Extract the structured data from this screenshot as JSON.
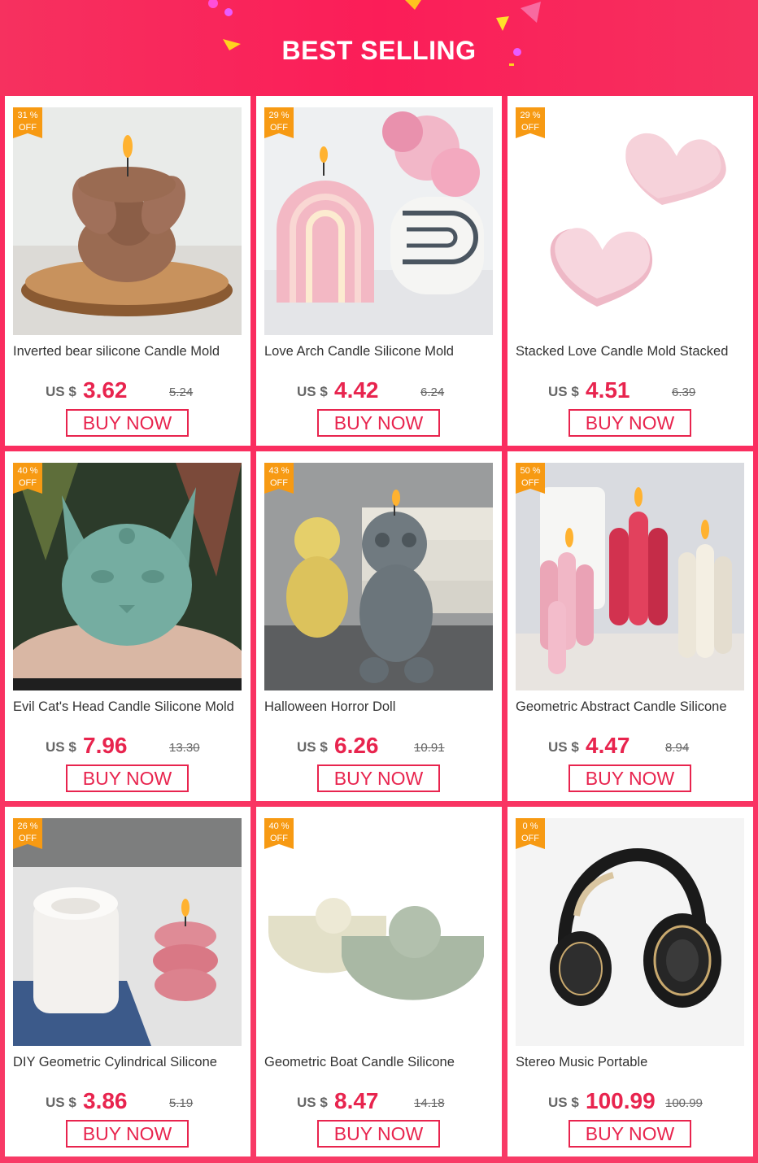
{
  "header": {
    "title": "BEST SELLING"
  },
  "colors": {
    "accent": "#e8244e",
    "badge": "#f79a13",
    "header_bg": "#fb1d58"
  },
  "products": [
    {
      "badge_pct": "31 %",
      "badge_off": "OFF",
      "title": "Inverted bear silicone Candle Mold",
      "currency": "US $",
      "price": "3.62",
      "old_price": "5.24",
      "button": "BUY NOW",
      "image": "bear-candle-image"
    },
    {
      "badge_pct": "29 %",
      "badge_off": "OFF",
      "title": "Love Arch Candle Silicone Mold",
      "currency": "US $",
      "price": "4.42",
      "old_price": "6.24",
      "button": "BUY NOW",
      "image": "arch-candle-image"
    },
    {
      "badge_pct": "29 %",
      "badge_off": "OFF",
      "title": "Stacked Love Candle Mold Stacked",
      "currency": "US $",
      "price": "4.51",
      "old_price": "6.39",
      "button": "BUY NOW",
      "image": "heart-candle-image"
    },
    {
      "badge_pct": "40 %",
      "badge_off": "OFF",
      "title": "Evil Cat's Head Candle Silicone Mold",
      "currency": "US $",
      "price": "7.96",
      "old_price": "13.30",
      "button": "BUY NOW",
      "image": "cat-head-candle-image"
    },
    {
      "badge_pct": "43 %",
      "badge_off": "OFF",
      "title": "Halloween Horror Doll",
      "currency": "US $",
      "price": "6.26",
      "old_price": "10.91",
      "button": "BUY NOW",
      "image": "horror-doll-candle-image"
    },
    {
      "badge_pct": "50 %",
      "badge_off": "OFF",
      "title": "Geometric Abstract Candle Silicone",
      "currency": "US $",
      "price": "4.47",
      "old_price": "8.94",
      "button": "BUY NOW",
      "image": "pillar-candles-image"
    },
    {
      "badge_pct": "26 %",
      "badge_off": "OFF",
      "title": "DIY Geometric Cylindrical Silicone",
      "currency": "US $",
      "price": "3.86",
      "old_price": "5.19",
      "button": "BUY NOW",
      "image": "cylinder-candle-image"
    },
    {
      "badge_pct": "40 %",
      "badge_off": "OFF",
      "title": "Geometric Boat Candle Silicone",
      "currency": "US $",
      "price": "8.47",
      "old_price": "14.18",
      "button": "BUY NOW",
      "image": "boat-candle-image"
    },
    {
      "badge_pct": "0 %",
      "badge_off": "OFF",
      "title": "Stereo Music Portable",
      "currency": "US $",
      "price": "100.99",
      "old_price": "100.99",
      "button": "BUY NOW",
      "image": "headphones-image"
    }
  ]
}
